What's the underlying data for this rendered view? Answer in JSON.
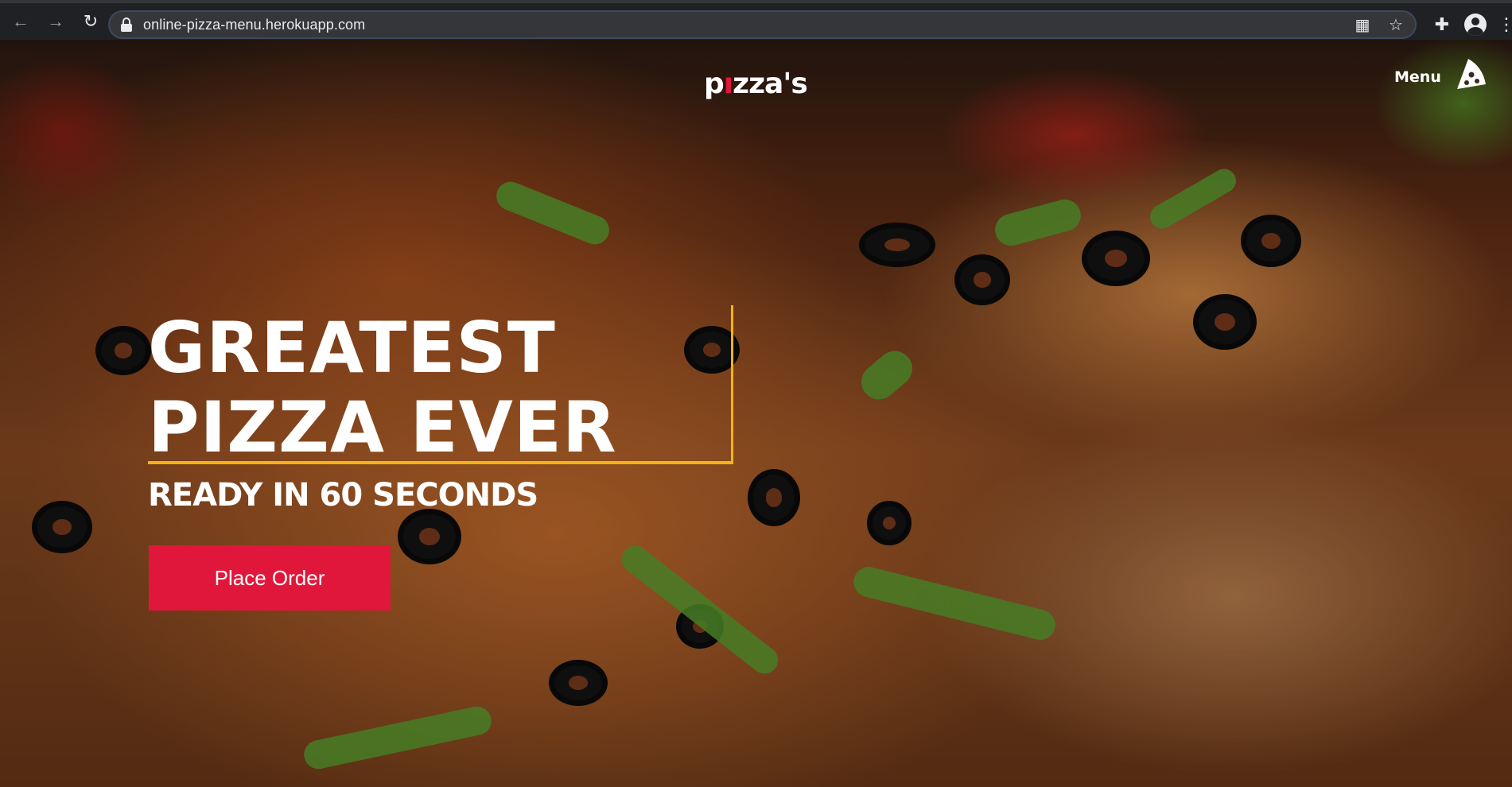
{
  "browser": {
    "back_icon": "arrow-left-icon",
    "forward_icon": "arrow-right-icon",
    "reload_icon": "reload-icon",
    "lock_icon": "lock-icon",
    "url": "online-pizza-menu.herokuapp.com",
    "qr_icon": "qr-code-icon",
    "bookmark_icon": "star-icon",
    "extensions_icon": "puzzle-icon",
    "profile_icon": "account-icon",
    "menu_icon": "kebab-menu-icon"
  },
  "site": {
    "logo_prefix": "p",
    "logo_dot": "ı",
    "logo_suffix": "zza's",
    "nav_menu_label": "Menu",
    "nav_icon": "pizza-slice-icon",
    "headline_line1": "GREATEST",
    "headline_line2": "PIZZA EVER",
    "subheadline": "READY IN 60 SECONDS",
    "cta_label": "Place Order"
  },
  "colors": {
    "accent_red": "#e0173a",
    "accent_gold": "#f5b312",
    "chrome_bg": "#202124"
  }
}
